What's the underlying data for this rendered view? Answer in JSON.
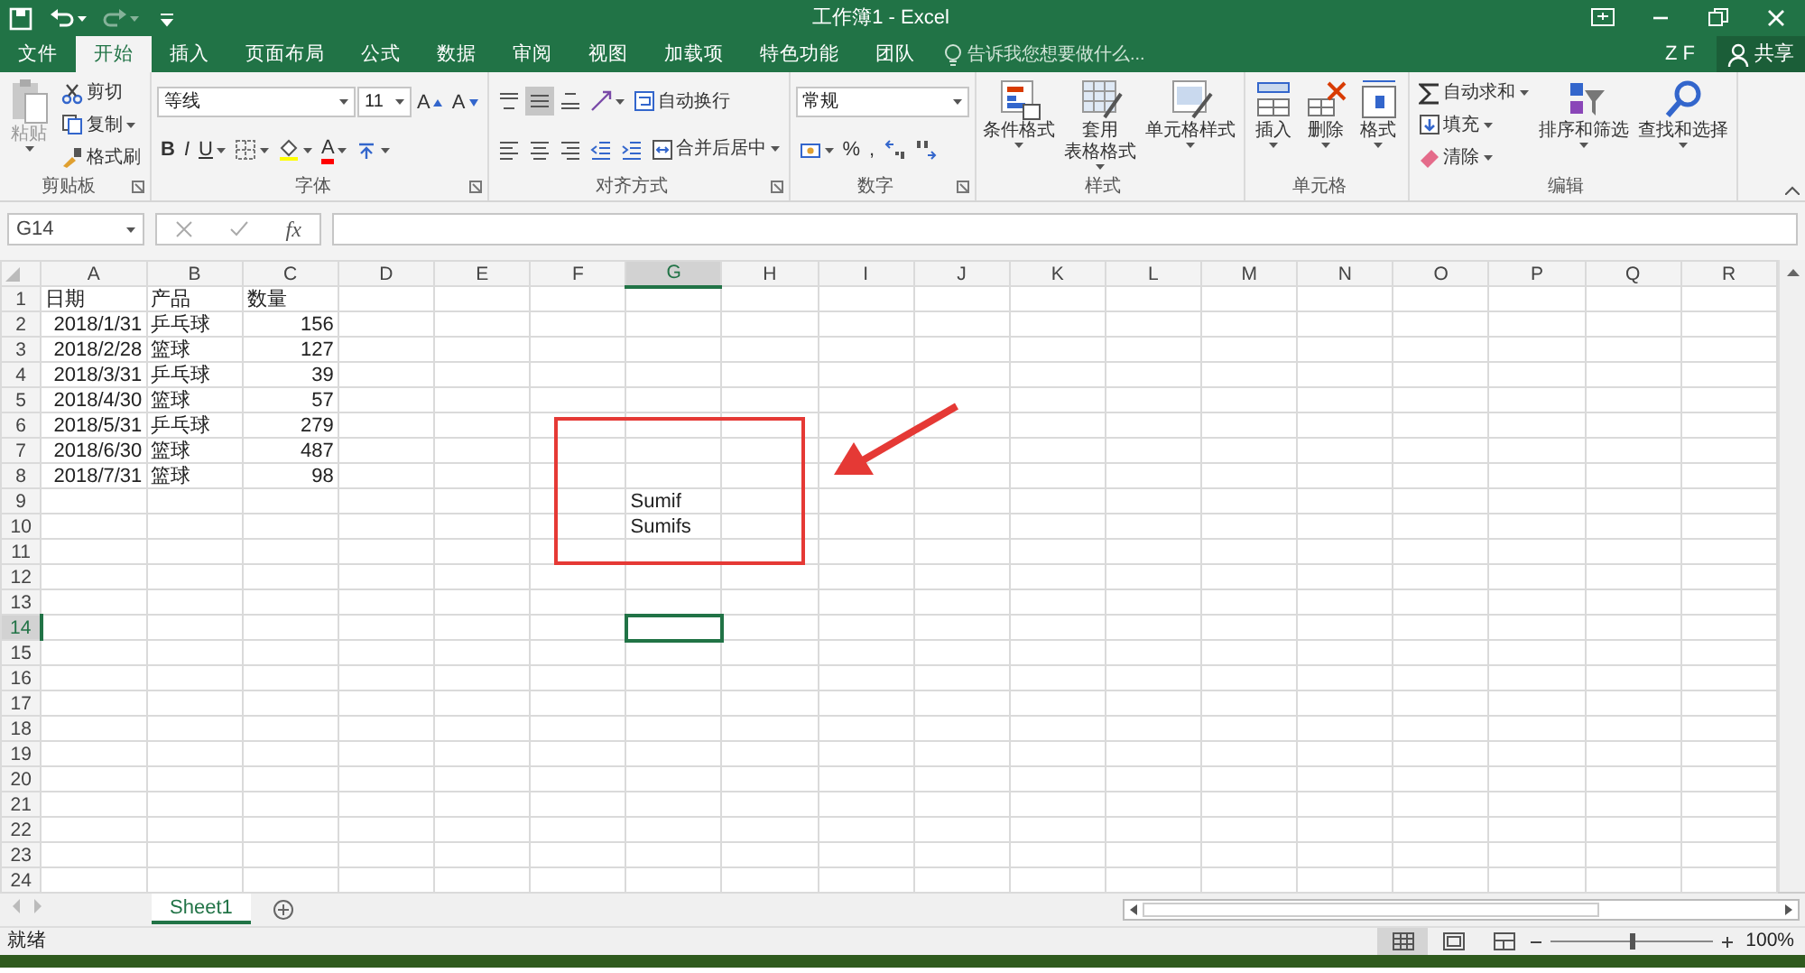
{
  "window": {
    "title": "工作簿1 - Excel",
    "quick_access": [
      {
        "kind": "save"
      },
      {
        "kind": "undo"
      },
      {
        "kind": "redo"
      },
      {
        "kind": "customize"
      }
    ]
  },
  "tabs": [
    {
      "label": "文件",
      "selected": false
    },
    {
      "label": "开始",
      "selected": true
    },
    {
      "label": "插入",
      "selected": false
    },
    {
      "label": "页面布局",
      "selected": false
    },
    {
      "label": "公式",
      "selected": false
    },
    {
      "label": "数据",
      "selected": false
    },
    {
      "label": "审阅",
      "selected": false
    },
    {
      "label": "视图",
      "selected": false
    },
    {
      "label": "加载项",
      "selected": false
    },
    {
      "label": "特色功能",
      "selected": false
    },
    {
      "label": "团队",
      "selected": false
    }
  ],
  "tell_me": {
    "placeholder": "告诉我您想要做什么..."
  },
  "user": "Z F",
  "share": "共享",
  "ribbon": [
    {
      "label": "剪贴板",
      "launcher": true,
      "items": [
        {
          "kind": "large",
          "label": [
            "粘贴"
          ],
          "dropdown": true,
          "disabled": true
        },
        {
          "kind": "stack",
          "lines": [
            [
              {
                "kind": "small",
                "label": "剪切",
                "dropdown": false
              }
            ],
            [
              {
                "kind": "small",
                "label": "复制",
                "dropdown": true
              }
            ],
            [
              {
                "kind": "small",
                "label": "格式刷",
                "dropdown": false
              }
            ]
          ]
        }
      ]
    },
    {
      "label": "字体",
      "launcher": true,
      "items": [
        {
          "kind": "stack",
          "lines": [
            [
              {
                "kind": "fontbox",
                "value": "等线"
              },
              {
                "kind": "sizebox",
                "value": "11"
              },
              {
                "kind": "grow",
                "label": "A"
              },
              {
                "kind": "shrink",
                "label": "A"
              }
            ],
            [
              {
                "kind": "bold",
                "label": "B",
                "dropdown": false
              },
              {
                "kind": "italic",
                "label": "I",
                "dropdown": false
              },
              {
                "kind": "underline",
                "label": "U",
                "dropdown": true
              },
              {
                "kind": "tool",
                "dropdown": true,
                "selected": false
              },
              {
                "kind": "tool",
                "dropdown": true,
                "selected": false,
                "color": "#ffff00"
              },
              {
                "kind": "fontcolor",
                "label": "A",
                "dropdown": true,
                "color": "#ff0000"
              },
              {
                "kind": "tool",
                "dropdown": true,
                "selected": false
              }
            ]
          ]
        }
      ]
    },
    {
      "label": "对齐方式",
      "launcher": true,
      "items": [
        {
          "kind": "stack",
          "lines": [
            [
              {
                "kind": "tool",
                "dropdown": false,
                "selected": false
              },
              {
                "kind": "tool",
                "dropdown": false,
                "selected": true
              },
              {
                "kind": "tool",
                "dropdown": false,
                "selected": false
              },
              {
                "kind": "tool",
                "dropdown": true,
                "selected": false
              },
              {
                "kind": "small",
                "label": "自动换行",
                "dropdown": false
              }
            ],
            [
              {
                "kind": "tool",
                "dropdown": false,
                "selected": false
              },
              {
                "kind": "tool",
                "dropdown": false,
                "selected": false
              },
              {
                "kind": "tool",
                "dropdown": false,
                "selected": false
              },
              {
                "kind": "tool",
                "dropdown": false,
                "selected": false
              },
              {
                "kind": "tool",
                "dropdown": false,
                "selected": false
              },
              {
                "kind": "small",
                "label": "合并后居中",
                "dropdown": true
              }
            ]
          ]
        }
      ]
    },
    {
      "label": "数字",
      "launcher": true,
      "items": [
        {
          "kind": "stack",
          "lines": [
            [
              {
                "kind": "formatbox",
                "value": "常规"
              }
            ],
            [
              {
                "kind": "tool",
                "dropdown": true,
                "selected": false
              },
              {
                "kind": "plain",
                "label": "%",
                "dropdown": false
              },
              {
                "kind": "plain",
                "label": ",",
                "dropdown": false
              },
              {
                "kind": "tool",
                "dropdown": false,
                "selected": false
              },
              {
                "kind": "tool",
                "dropdown": false,
                "selected": false
              }
            ]
          ]
        }
      ]
    },
    {
      "label": "样式",
      "launcher": false,
      "items": [
        {
          "kind": "large",
          "label": [
            "条件格式"
          ],
          "dropdown": true,
          "disabled": false
        },
        {
          "kind": "large",
          "label": [
            "套用",
            "表格格式"
          ],
          "dropdown": true,
          "disabled": false
        },
        {
          "kind": "large",
          "label": [
            "单元格样式"
          ],
          "dropdown": true,
          "disabled": false
        }
      ]
    },
    {
      "label": "单元格",
      "launcher": false,
      "items": [
        {
          "kind": "large",
          "label": [
            "插入"
          ],
          "dropdown": true,
          "disabled": false
        },
        {
          "kind": "large",
          "label": [
            "删除"
          ],
          "dropdown": true,
          "disabled": false
        },
        {
          "kind": "large",
          "label": [
            "格式"
          ],
          "dropdown": true,
          "disabled": false
        }
      ]
    },
    {
      "label": "编辑",
      "launcher": false,
      "items": [
        {
          "kind": "stack",
          "lines": [
            [
              {
                "kind": "small",
                "label": "自动求和",
                "dropdown": true
              }
            ],
            [
              {
                "kind": "small",
                "label": "填充",
                "dropdown": true
              }
            ],
            [
              {
                "kind": "small",
                "label": "清除",
                "dropdown": true
              }
            ]
          ]
        },
        {
          "kind": "large",
          "label": [
            "排序和筛选"
          ],
          "dropdown": true,
          "disabled": false
        },
        {
          "kind": "large",
          "label": [
            "查找和选择"
          ],
          "dropdown": true,
          "disabled": false
        }
      ]
    }
  ],
  "formula_bar": {
    "name_box": "G14",
    "function_label": "fx"
  },
  "sheet": {
    "columns": [
      {
        "label": "A",
        "selected": false
      },
      {
        "label": "B",
        "selected": false
      },
      {
        "label": "C",
        "selected": false
      },
      {
        "label": "D",
        "selected": false
      },
      {
        "label": "E",
        "selected": false
      },
      {
        "label": "F",
        "selected": false
      },
      {
        "label": "G",
        "selected": true
      },
      {
        "label": "H",
        "selected": false
      },
      {
        "label": "I",
        "selected": false
      },
      {
        "label": "J",
        "selected": false
      },
      {
        "label": "K",
        "selected": false
      },
      {
        "label": "L",
        "selected": false
      },
      {
        "label": "M",
        "selected": false
      },
      {
        "label": "N",
        "selected": false
      },
      {
        "label": "O",
        "selected": false
      },
      {
        "label": "P",
        "selected": false
      },
      {
        "label": "Q",
        "selected": false
      },
      {
        "label": "R",
        "selected": false
      }
    ],
    "rows": [
      {
        "label": "1",
        "selected": false,
        "cells": {
          "A": {
            "text": "日期",
            "kind": "text"
          },
          "B": {
            "text": "产品",
            "kind": "text"
          },
          "C": {
            "text": "数量",
            "kind": "text"
          }
        }
      },
      {
        "label": "2",
        "selected": false,
        "cells": {
          "A": {
            "text": "2018/1/31",
            "kind": "number"
          },
          "B": {
            "text": "乒乓球",
            "kind": "text"
          },
          "C": {
            "text": "156",
            "kind": "number"
          }
        }
      },
      {
        "label": "3",
        "selected": false,
        "cells": {
          "A": {
            "text": "2018/2/28",
            "kind": "number"
          },
          "B": {
            "text": "篮球",
            "kind": "text"
          },
          "C": {
            "text": "127",
            "kind": "number"
          }
        }
      },
      {
        "label": "4",
        "selected": false,
        "cells": {
          "A": {
            "text": "2018/3/31",
            "kind": "number"
          },
          "B": {
            "text": "乒乓球",
            "kind": "text"
          },
          "C": {
            "text": "39",
            "kind": "number"
          }
        }
      },
      {
        "label": "5",
        "selected": false,
        "cells": {
          "A": {
            "text": "2018/4/30",
            "kind": "number"
          },
          "B": {
            "text": "篮球",
            "kind": "text"
          },
          "C": {
            "text": "57",
            "kind": "number"
          }
        }
      },
      {
        "label": "6",
        "selected": false,
        "cells": {
          "A": {
            "text": "2018/5/31",
            "kind": "number"
          },
          "B": {
            "text": "乒乓球",
            "kind": "text"
          },
          "C": {
            "text": "279",
            "kind": "number"
          }
        }
      },
      {
        "label": "7",
        "selected": false,
        "cells": {
          "A": {
            "text": "2018/6/30",
            "kind": "number"
          },
          "B": {
            "text": "篮球",
            "kind": "text"
          },
          "C": {
            "text": "487",
            "kind": "number"
          }
        }
      },
      {
        "label": "8",
        "selected": false,
        "cells": {
          "A": {
            "text": "2018/7/31",
            "kind": "number"
          },
          "B": {
            "text": "篮球",
            "kind": "text"
          },
          "C": {
            "text": "98",
            "kind": "number"
          }
        }
      },
      {
        "label": "9",
        "selected": false,
        "cells": {
          "G": {
            "text": "Sumif",
            "kind": "text"
          }
        }
      },
      {
        "label": "10",
        "selected": false,
        "cells": {
          "G": {
            "text": "Sumifs",
            "kind": "text"
          }
        }
      },
      {
        "label": "11",
        "selected": false,
        "cells": {}
      },
      {
        "label": "12",
        "selected": false,
        "cells": {}
      },
      {
        "label": "13",
        "selected": false,
        "cells": {}
      },
      {
        "label": "14",
        "selected": true,
        "cells": {}
      },
      {
        "label": "15",
        "selected": false,
        "cells": {}
      },
      {
        "label": "16",
        "selected": false,
        "cells": {}
      },
      {
        "label": "17",
        "selected": false,
        "cells": {}
      },
      {
        "label": "18",
        "selected": false,
        "cells": {}
      },
      {
        "label": "19",
        "selected": false,
        "cells": {}
      },
      {
        "label": "20",
        "selected": false,
        "cells": {}
      },
      {
        "label": "21",
        "selected": false,
        "cells": {}
      },
      {
        "label": "22",
        "selected": false,
        "cells": {}
      },
      {
        "label": "23",
        "selected": false,
        "cells": {}
      },
      {
        "label": "24",
        "selected": false,
        "cells": {}
      }
    ]
  },
  "sheet_tabs": [
    {
      "label": "Sheet1",
      "selected": true
    }
  ],
  "status_bar": {
    "text": "就绪",
    "views": [
      {
        "kind": "normal",
        "selected": true
      },
      {
        "kind": "page_layout",
        "selected": false
      },
      {
        "kind": "page_break",
        "selected": false
      }
    ],
    "zoom": {
      "level": 0.5,
      "reading": "100%"
    }
  }
}
